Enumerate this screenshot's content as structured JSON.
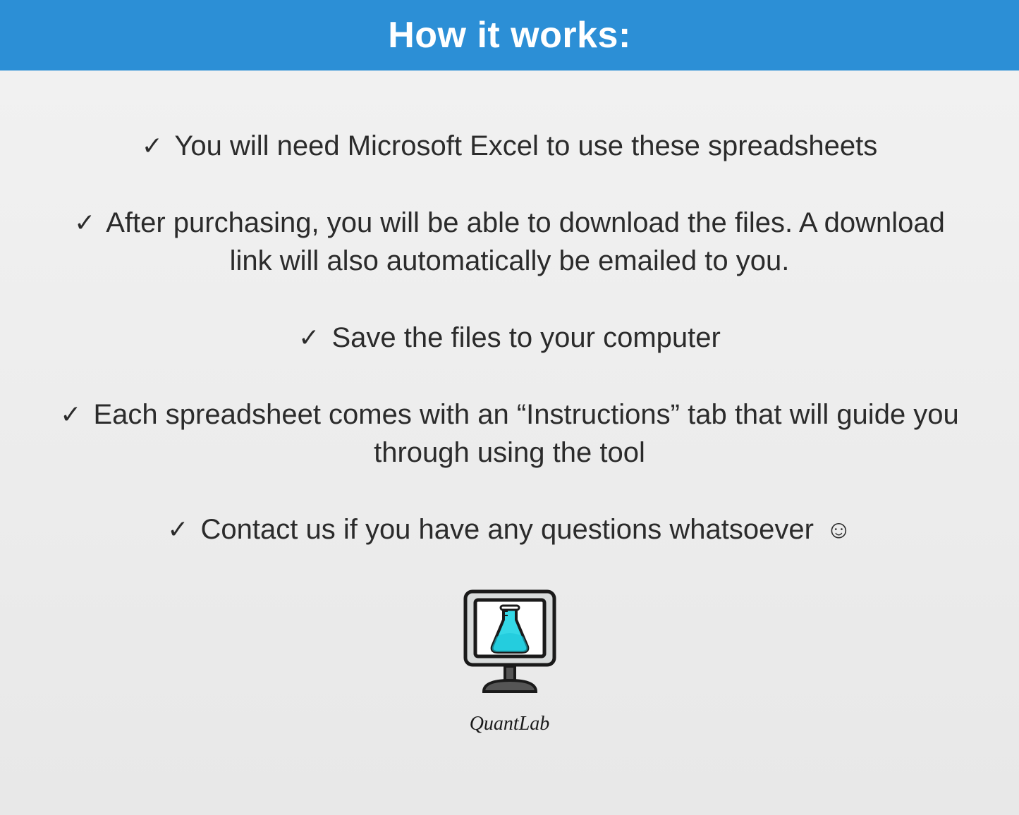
{
  "header": {
    "title": "How it works:"
  },
  "checkmark": "✓",
  "smiley": "☺",
  "items": [
    "You will need Microsoft Excel to use these spreadsheets",
    "After purchasing, you will be able to download the files. A download link will also automatically be emailed to you.",
    "Save the files to your computer",
    "Each spreadsheet comes with an “Instructions” tab that will guide you through using the tool",
    "Contact us if you have any questions whatsoever"
  ],
  "brand": "QuantLab"
}
